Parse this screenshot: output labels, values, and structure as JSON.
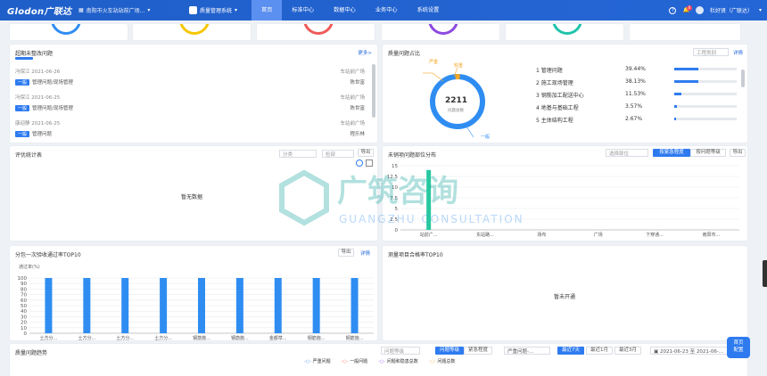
{
  "header": {
    "logo": "Glodon广联达",
    "project": "南阳市火车站站前广场...",
    "system": "质量管理系统",
    "nav": [
      "首页",
      "标准中心",
      "数据中心",
      "业务中心",
      "系统设置"
    ],
    "user": "杜好贤（广联达）",
    "help": "?",
    "badge": "0"
  },
  "pending": {
    "title": "超期未整改问题",
    "more": "更多>",
    "items": [
      {
        "person": "冯保江",
        "date": "2021-06-26",
        "loc": "车站前广场",
        "tag": "一般",
        "desc": "管理问题/现场管理",
        "owner": "陈世富"
      },
      {
        "person": "冯保江",
        "date": "2021-06-25",
        "loc": "车站前广场",
        "tag": "一般",
        "desc": "管理问题/现场管理",
        "owner": "陈世富"
      },
      {
        "person": "康迎静",
        "date": "2021-06-25",
        "loc": "车站前广场",
        "tag": "一般",
        "desc": "管理问题",
        "owner": "程乐林"
      }
    ]
  },
  "ratio": {
    "title": "质量问题占比",
    "select": "工程类别",
    "detail": "详情",
    "total": "2211",
    "total_label": "问题总数",
    "legend_top": "严重",
    "legend_top2": "较重",
    "legend_bottom": "一般",
    "rows": [
      {
        "name": "1 管理问题",
        "pct": "39.44%",
        "v": 39.44
      },
      {
        "name": "2 施工现场管理",
        "pct": "38.13%",
        "v": 38.13
      },
      {
        "name": "3 钢筋加工配送中心",
        "pct": "11.53%",
        "v": 11.53
      },
      {
        "name": "4 地基与基础工程",
        "pct": "3.57%",
        "v": 3.57
      },
      {
        "name": "5 主体结构工程",
        "pct": "2.67%",
        "v": 2.67
      }
    ]
  },
  "eval": {
    "title": "评优统计表",
    "sel1": "分类",
    "sel2": "检部",
    "export": "导出",
    "empty": "暂无数据"
  },
  "unsales": {
    "title": "未销项问题部位分布",
    "sel": "选择部位",
    "tab1": "按紧急程度",
    "tab2": "按问题等级",
    "export": "导出",
    "chart_data": {
      "type": "bar",
      "categories": [
        "站前广...",
        "东站路...",
        "场布",
        "广场",
        "下穿通...",
        "南阳市..."
      ],
      "values": [
        14,
        0,
        0,
        0,
        0,
        0
      ],
      "yticks": [
        0,
        2.5,
        5,
        7.5,
        10,
        12.5,
        15
      ],
      "ylim": [
        0,
        15
      ]
    }
  },
  "pass": {
    "title": "分包一次验收通过率TOP10",
    "export": "导出",
    "detail": "详情",
    "ylabel": "通过率(%)",
    "chart_data": {
      "type": "bar",
      "categories": [
        "土方分...",
        "土方分...",
        "土方分...",
        "土方分...",
        "钢筋施...",
        "钢筋施...",
        "金都草...",
        "钢筋施...",
        "钢筋施..."
      ],
      "values": [
        100,
        100,
        100,
        100,
        100,
        100,
        100,
        100,
        100
      ],
      "yticks": [
        0,
        10,
        20,
        30,
        40,
        50,
        60,
        70,
        80,
        90,
        100
      ],
      "ylim": [
        0,
        100
      ]
    }
  },
  "score": {
    "title": "测量项目合格率TOP10",
    "empty": "暂未开通"
  },
  "trend": {
    "title": "质量问题趋势",
    "sel": "问题等级",
    "tab1": "问题等级",
    "tab2": "紧急程度",
    "sel2": "严重问题-...",
    "r1": "最近7天",
    "r2": "最近1月",
    "r3": "最近3月",
    "date1": "2021-06-23",
    "to": "至",
    "date2": "2021-06-...",
    "legend": [
      {
        "name": "严重问题",
        "color": "#5b9bf5"
      },
      {
        "name": "一般问题",
        "color": "#f07d6a"
      },
      {
        "name": "问题和隐患总数",
        "color": "#9a62e8"
      },
      {
        "name": "问题总数",
        "color": "#f5b86a"
      }
    ]
  },
  "float": {
    "l1": "首页",
    "l2": "配置"
  },
  "watermark": {
    "cn": "广筑咨询",
    "en": "GUANGZHU CONSULTATION"
  }
}
